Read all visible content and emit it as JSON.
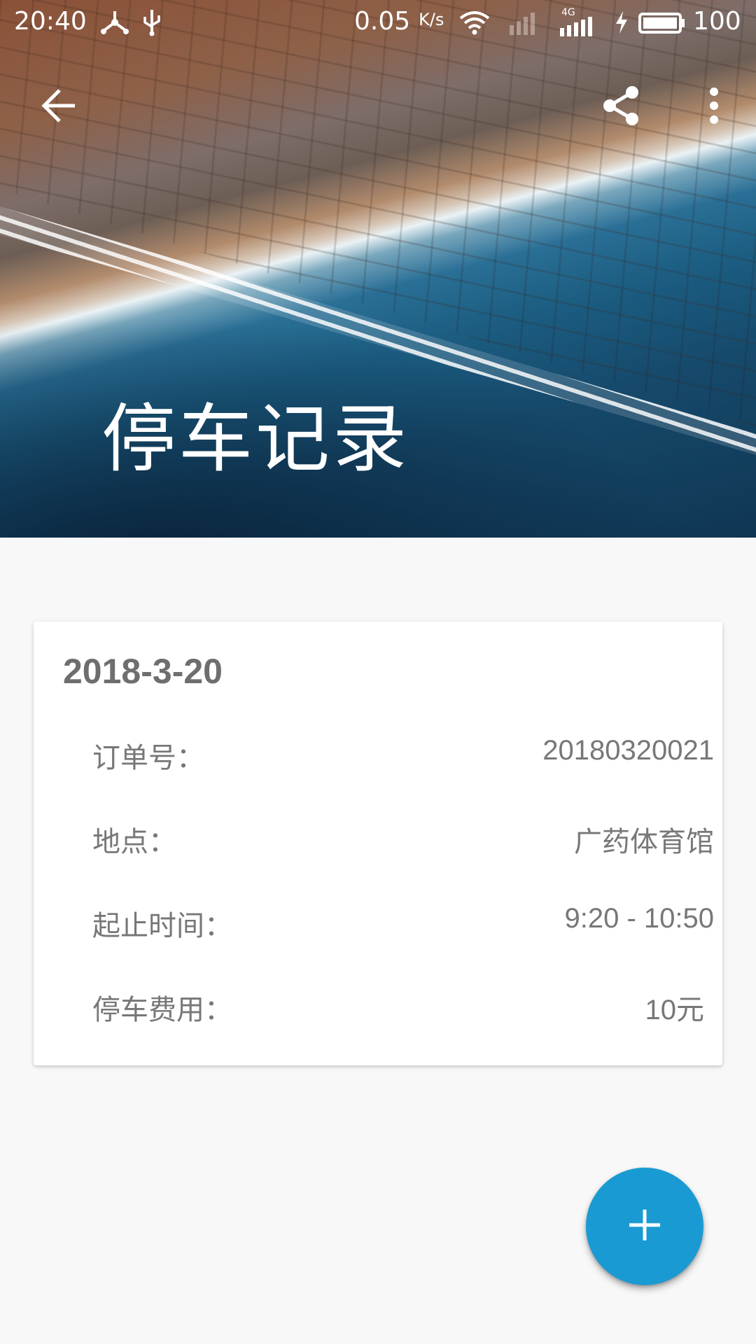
{
  "status_bar": {
    "time": "20:40",
    "net_speed": "0.05",
    "net_unit": "K/s",
    "network_type": "4G",
    "battery": "100",
    "icons": [
      "usb-tether-icon",
      "usb-icon",
      "wifi-icon",
      "signal-icon",
      "charging-icon",
      "battery-icon"
    ]
  },
  "toolbar": {
    "title": "停车记录",
    "back_icon": "arrow-left-icon",
    "share_icon": "share-icon",
    "more_icon": "more-vert-icon"
  },
  "record": {
    "date": "2018-3-20",
    "rows": [
      {
        "label": "订单号：",
        "value": "20180320021"
      },
      {
        "label": "地点：",
        "value": "广药体育馆"
      },
      {
        "label": "起止时间：",
        "value": "9:20 - 10:50"
      },
      {
        "label": "停车费用：",
        "value": "10元"
      }
    ]
  },
  "fab": {
    "icon": "plus-icon",
    "color": "#1a9ad3"
  }
}
